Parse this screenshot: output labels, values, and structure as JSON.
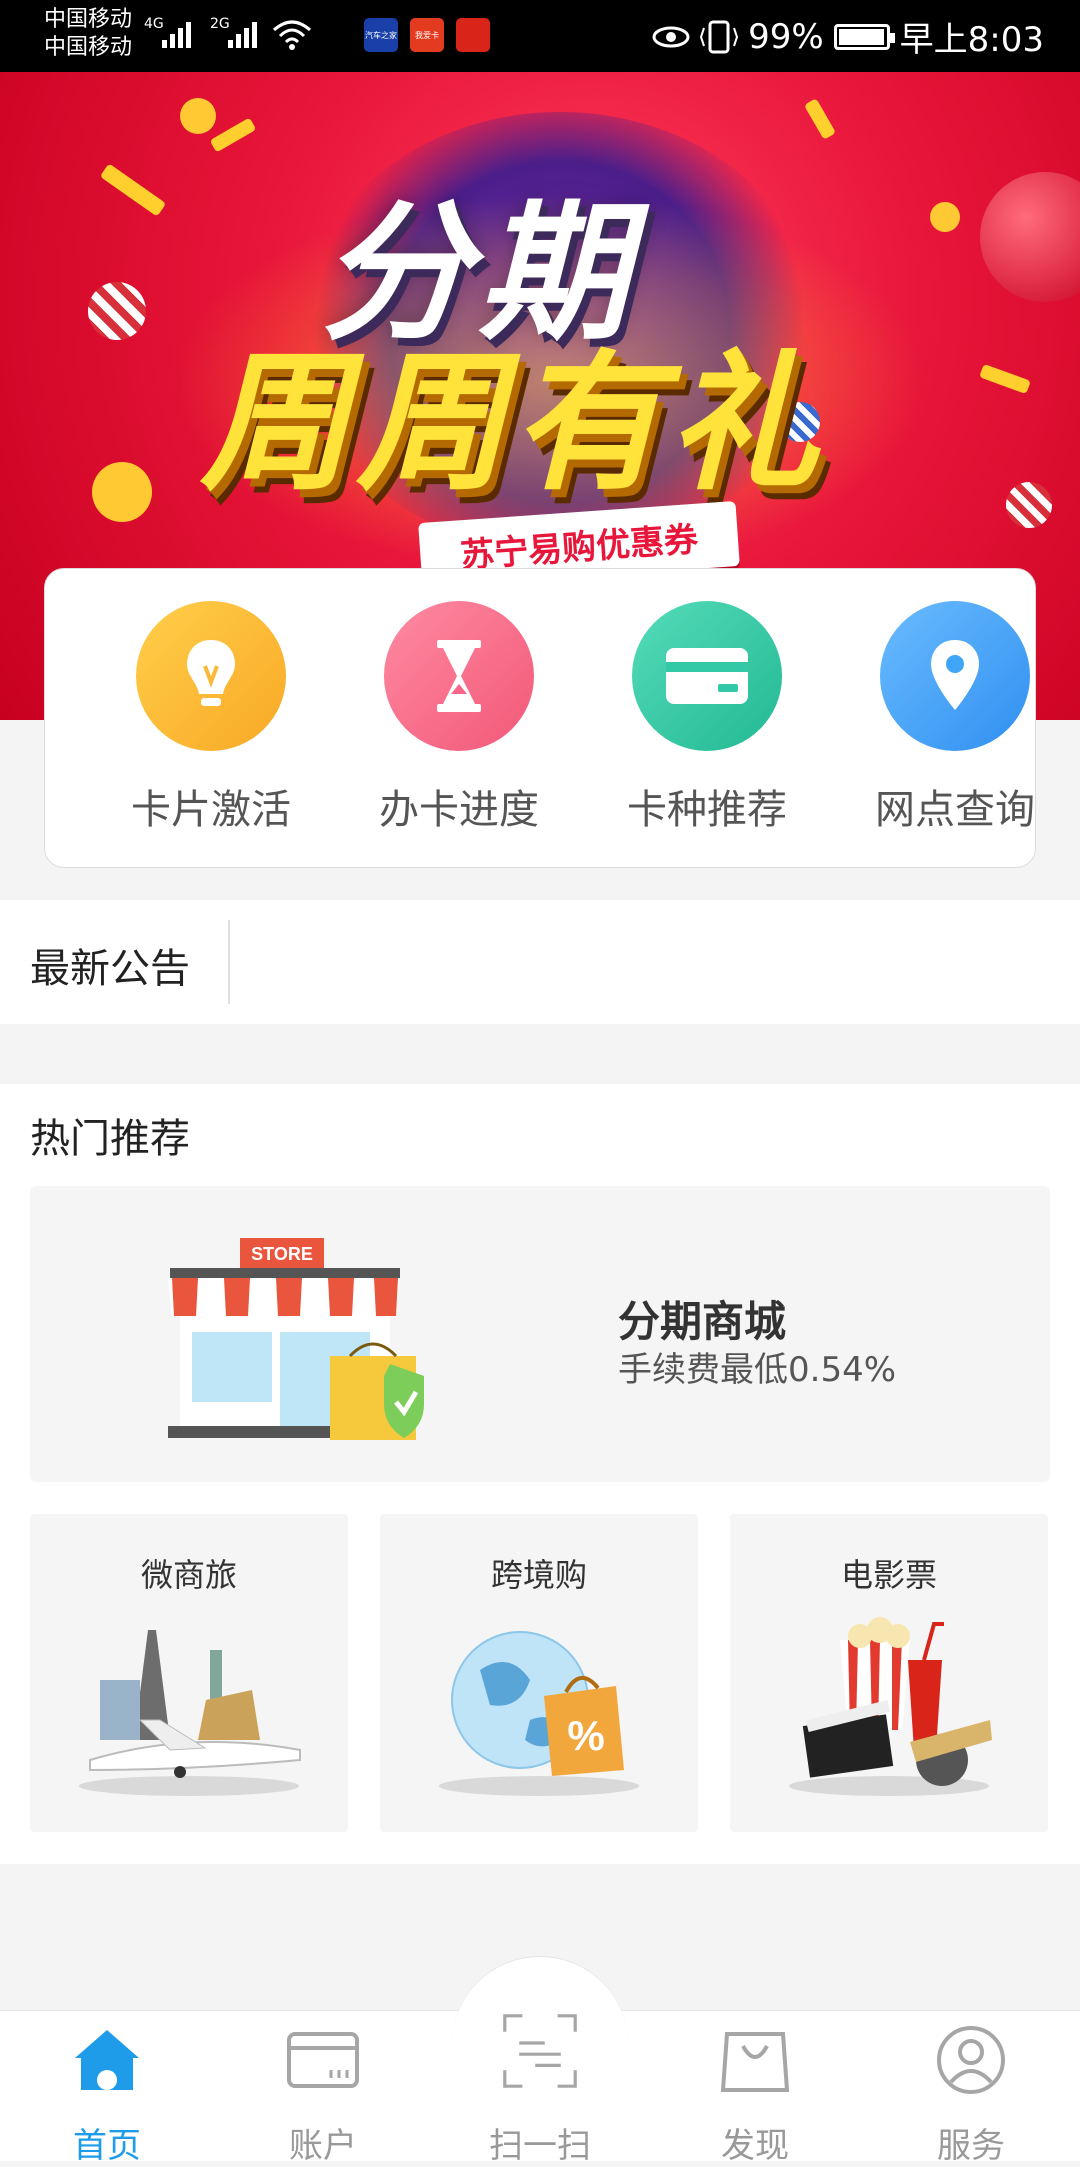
{
  "status_bar": {
    "carrier1": "中国移动",
    "carrier2": "中国移动",
    "net1": "4G",
    "net2": "2G",
    "battery_percent": "99%",
    "battery_level": 0.99,
    "time": "早上8:03",
    "app_icons": [
      "汽车之家",
      "我爱卡",
      "app"
    ]
  },
  "banner": {
    "line1": "分期",
    "line2": "周周有礼",
    "ribbon": "苏宁易购优惠券"
  },
  "quick_actions": [
    {
      "label": "卡片激活",
      "icon": "lightbulb-icon",
      "color": "#fbb93a"
    },
    {
      "label": "办卡进度",
      "icon": "hourglass-icon",
      "color": "#f76688"
    },
    {
      "label": "卡种推荐",
      "icon": "card-icon",
      "color": "#33c9a6"
    },
    {
      "label": "网点查询",
      "icon": "location-pin-icon",
      "color": "#3fa6f7"
    }
  ],
  "notice": {
    "title": "最新公告"
  },
  "hot": {
    "title": "热门推荐",
    "mall": {
      "name": "分期商城",
      "desc": "手续费最低0.54%",
      "store_sign": "STORE"
    },
    "tiles": [
      {
        "name": "微商旅"
      },
      {
        "name": "跨境购"
      },
      {
        "name": "电影票"
      }
    ]
  },
  "nav": [
    {
      "label": "首页",
      "icon": "home-icon",
      "active": true
    },
    {
      "label": "账户",
      "icon": "card-icon",
      "active": false
    },
    {
      "label": "扫一扫",
      "icon": "scan-icon",
      "active": false
    },
    {
      "label": "发现",
      "icon": "bag-icon",
      "active": false
    },
    {
      "label": "服务",
      "icon": "user-icon",
      "active": false
    }
  ],
  "colors": {
    "accent": "#1e9be9",
    "banner_red": "#e8163a"
  }
}
